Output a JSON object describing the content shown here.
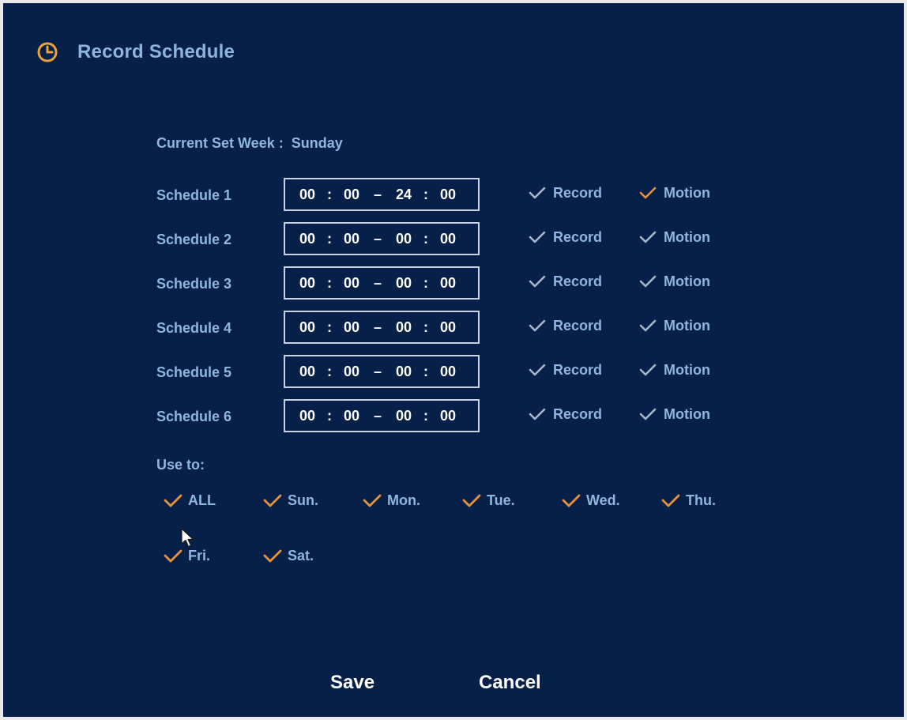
{
  "title": "Record Schedule",
  "current_week": {
    "label": "Current Set Week :",
    "value": "Sunday"
  },
  "schedules": [
    {
      "label": "Schedule 1",
      "start_h": "00",
      "start_m": "00",
      "end_h": "24",
      "end_m": "00",
      "record_label": "Record",
      "record_checked": false,
      "motion_label": "Motion",
      "motion_checked": true
    },
    {
      "label": "Schedule 2",
      "start_h": "00",
      "start_m": "00",
      "end_h": "00",
      "end_m": "00",
      "record_label": "Record",
      "record_checked": false,
      "motion_label": "Motion",
      "motion_checked": false
    },
    {
      "label": "Schedule 3",
      "start_h": "00",
      "start_m": "00",
      "end_h": "00",
      "end_m": "00",
      "record_label": "Record",
      "record_checked": false,
      "motion_label": "Motion",
      "motion_checked": false
    },
    {
      "label": "Schedule 4",
      "start_h": "00",
      "start_m": "00",
      "end_h": "00",
      "end_m": "00",
      "record_label": "Record",
      "record_checked": false,
      "motion_label": "Motion",
      "motion_checked": false
    },
    {
      "label": "Schedule 5",
      "start_h": "00",
      "start_m": "00",
      "end_h": "00",
      "end_m": "00",
      "record_label": "Record",
      "record_checked": false,
      "motion_label": "Motion",
      "motion_checked": false
    },
    {
      "label": "Schedule 6",
      "start_h": "00",
      "start_m": "00",
      "end_h": "00",
      "end_m": "00",
      "record_label": "Record",
      "record_checked": false,
      "motion_label": "Motion",
      "motion_checked": false
    }
  ],
  "time_separators": {
    "colon": ":",
    "dash": "–"
  },
  "use_to": {
    "label": "Use to:",
    "days": [
      {
        "key": "all",
        "label": "ALL",
        "checked": true
      },
      {
        "key": "sun",
        "label": "Sun.",
        "checked": true
      },
      {
        "key": "mon",
        "label": "Mon.",
        "checked": true
      },
      {
        "key": "tue",
        "label": "Tue.",
        "checked": true
      },
      {
        "key": "wed",
        "label": "Wed.",
        "checked": true
      },
      {
        "key": "thu",
        "label": "Thu.",
        "checked": true
      },
      {
        "key": "fri",
        "label": "Fri.",
        "checked": true
      },
      {
        "key": "sat",
        "label": "Sat.",
        "checked": true
      }
    ]
  },
  "buttons": {
    "save": "Save",
    "cancel": "Cancel"
  },
  "icons": {
    "title": "clock-icon",
    "check": "checkmark-icon",
    "pointer": "mouse-cursor-icon"
  },
  "colors": {
    "background": "#06204a",
    "text": "#8fb6dd",
    "accent_checked": "#e8933a",
    "unchecked_mark": "#a9b8c8",
    "time_text": "#ffffff"
  }
}
